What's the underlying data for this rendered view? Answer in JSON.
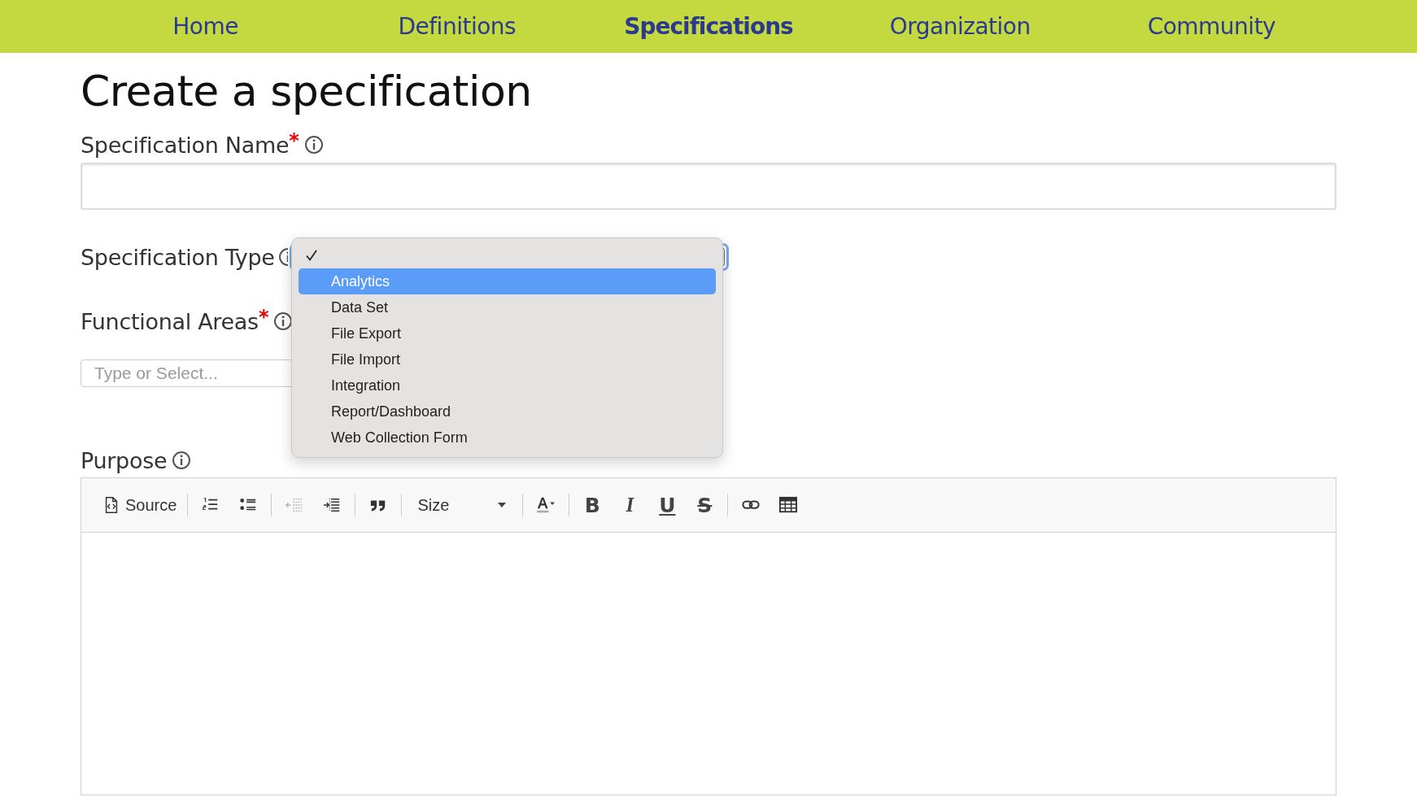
{
  "nav": [
    {
      "label": "Home",
      "selected": false
    },
    {
      "label": "Definitions",
      "selected": false
    },
    {
      "label": "Specifications",
      "selected": true
    },
    {
      "label": "Organization",
      "selected": false
    },
    {
      "label": "Community",
      "selected": false
    }
  ],
  "title": "Create a specification",
  "spec_name": {
    "label": "Specification Name",
    "required_mark": "*"
  },
  "spec_type": {
    "label": "Specification Type",
    "options": [
      {
        "checked": true,
        "selected": false
      },
      {
        "label": "Analytics",
        "checked": false,
        "selected": true
      },
      {
        "label": "Data Set",
        "checked": false,
        "selected": false
      },
      {
        "label": "File Export",
        "checked": false,
        "selected": false
      },
      {
        "label": "File Import",
        "checked": false,
        "selected": false
      },
      {
        "label": "Integration",
        "checked": false,
        "selected": false
      },
      {
        "label": "Report/Dashboard",
        "checked": false,
        "selected": false
      },
      {
        "label": "Web Collection Form",
        "checked": false,
        "selected": false
      }
    ]
  },
  "functional_areas": {
    "label": "Functional Areas",
    "required_mark": "*",
    "placeholder": "Type or Select..."
  },
  "purpose": {
    "label": "Purpose",
    "toolbar": [
      [
        {
          "kind": "source",
          "label": "Source",
          "disabled": false
        }
      ],
      [
        {
          "kind": "numbered-list",
          "disabled": false
        },
        {
          "kind": "bulleted-list",
          "disabled": false
        }
      ],
      [
        {
          "kind": "outdent",
          "disabled": true
        },
        {
          "kind": "indent",
          "disabled": false
        }
      ],
      [
        {
          "kind": "blockquote",
          "disabled": false
        }
      ],
      [
        {
          "kind": "size",
          "label": "Size",
          "disabled": false
        }
      ],
      [
        {
          "kind": "text-color",
          "disabled": false
        }
      ],
      [
        {
          "kind": "bold",
          "glyph": "B",
          "disabled": false
        },
        {
          "kind": "italic",
          "glyph": "I",
          "disabled": false
        },
        {
          "kind": "underline",
          "glyph": "U",
          "disabled": false
        },
        {
          "kind": "strike",
          "glyph": "S",
          "disabled": false
        }
      ],
      [
        {
          "kind": "link",
          "disabled": false
        },
        {
          "kind": "table",
          "disabled": false
        }
      ]
    ]
  }
}
